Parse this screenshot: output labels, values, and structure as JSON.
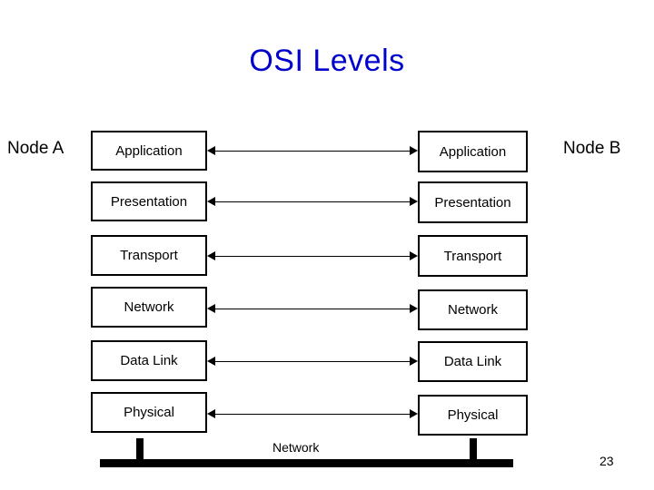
{
  "slide": {
    "title": "OSI Levels",
    "page_number": "23",
    "network_label": "Network",
    "accent_color": "#0000cc",
    "line_color": "#000000",
    "background_color": "#ffffff"
  },
  "nodes": {
    "left_label": "Node A",
    "right_label": "Node B"
  },
  "layers": [
    {
      "name": "Application",
      "left_label": "Application",
      "right_label": "Application"
    },
    {
      "name": "Presentation",
      "left_label": "Presentation",
      "right_label": "Presentation"
    },
    {
      "name": "Transport",
      "left_label": "Transport",
      "right_label": "Transport"
    },
    {
      "name": "Network",
      "left_label": "Network",
      "right_label": "Network"
    },
    {
      "name": "Data Link",
      "left_label": "Data Link",
      "right_label": "Data Link"
    },
    {
      "name": "Physical",
      "left_label": "Physical",
      "right_label": "Physical"
    }
  ]
}
